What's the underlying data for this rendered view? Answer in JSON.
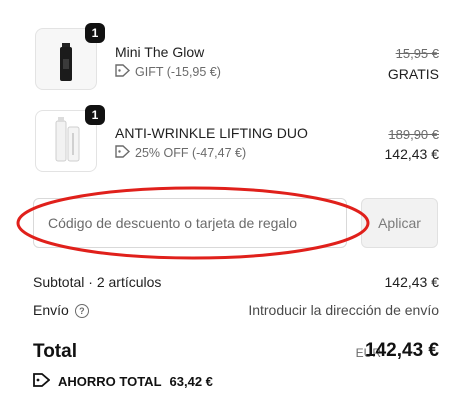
{
  "items": [
    {
      "name": "Mini The Glow",
      "quantity": "1",
      "discount_text": "GIFT (-15,95 €)",
      "original_price": "15,95 €",
      "final_price": "GRATIS",
      "icon": "tag-icon"
    },
    {
      "name": "ANTI-WRINKLE LIFTING DUO",
      "quantity": "1",
      "discount_text": "25% OFF (-47,47 €)",
      "original_price": "189,90 €",
      "final_price": "142,43 €",
      "icon": "tag-icon"
    }
  ],
  "discount": {
    "placeholder": "Código de descuento o tarjeta de regalo",
    "apply_label": "Aplicar"
  },
  "summary": {
    "subtotal_label": "Subtotal · 2 artículos",
    "subtotal_value": "142,43 €",
    "shipping_label": "Envío",
    "shipping_value": "Introducir la dirección de envío"
  },
  "total": {
    "label": "Total",
    "currency": "EUR",
    "value": "142,43 €"
  },
  "savings": {
    "label": "AHORRO TOTAL",
    "value": "63,42 €"
  },
  "colors": {
    "annotation": "#e0201b",
    "badge": "#111111",
    "muted": "#6b6b6b"
  }
}
